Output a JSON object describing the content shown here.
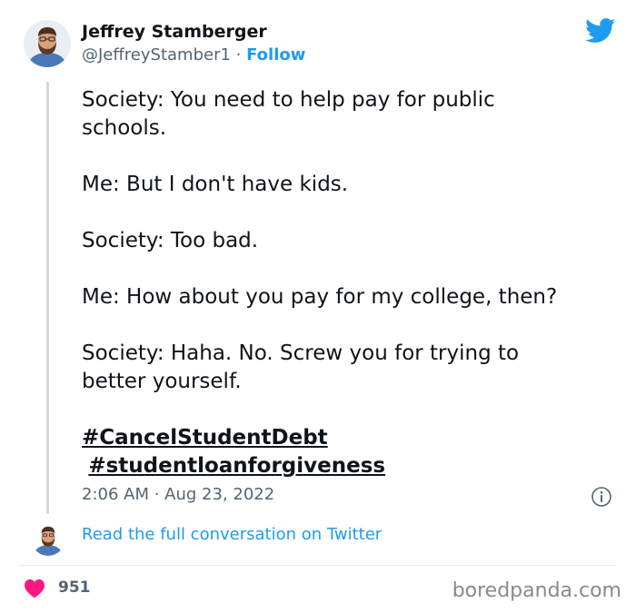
{
  "author": {
    "name": "Jeffrey Stamberger",
    "handle": "@JeffreyStamber1",
    "separator": " · ",
    "follow_label": "Follow"
  },
  "tweet": {
    "lines": [
      "Society: You need to help pay for public",
      "schools.",
      "Me: But I don't have kids.",
      "Society: Too bad.",
      "Me: How about you pay for my college, then?",
      "Society: Haha. No. Screw you for trying to",
      "better yourself."
    ],
    "hashtags": [
      "#CancelStudentDebt",
      "#studentloanforgiveness"
    ],
    "time": "2:06 AM",
    "date_separator": " · ",
    "date": "Aug 23, 2022"
  },
  "read_more_label": "Read the full conversation on Twitter",
  "likes": "951",
  "watermark": "boredpanda.com",
  "colors": {
    "twitter_blue": "#1d9bf0",
    "heart": "#f91880",
    "muted": "#536471"
  },
  "icons": [
    "twitter-bird-icon",
    "info-icon",
    "heart-icon"
  ]
}
